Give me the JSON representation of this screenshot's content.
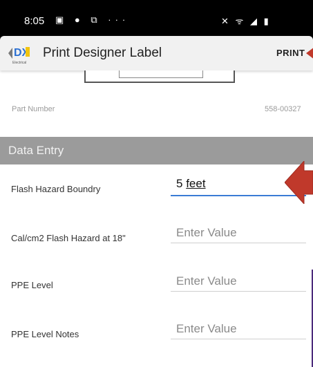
{
  "status_bar": {
    "time": "8:05",
    "left_icons": "▣ ● ⧉ ···",
    "right_icons": "✕ ᯤ ◢ ▮"
  },
  "app_bar": {
    "title": "Print Designer Label",
    "print_label": "PRINT",
    "logo_text": "DX",
    "logo_subtext": "Electrical"
  },
  "part": {
    "label": "Part Number",
    "value": "558-00327"
  },
  "section": {
    "title": "Data Entry"
  },
  "fields": [
    {
      "label": "Flash Hazard Boundry",
      "value_num": "5",
      "value_unit": "feet"
    },
    {
      "label": "Cal/cm2 Flash Hazard at 18\"",
      "placeholder": "Enter Value"
    },
    {
      "label": "PPE Level",
      "placeholder": "Enter Value"
    },
    {
      "label": "PPE Level Notes",
      "placeholder": "Enter Value"
    }
  ],
  "colors": {
    "accent": "#3a7bd5",
    "arrow": "#c0392b",
    "section_bg": "#9b9b9b"
  }
}
